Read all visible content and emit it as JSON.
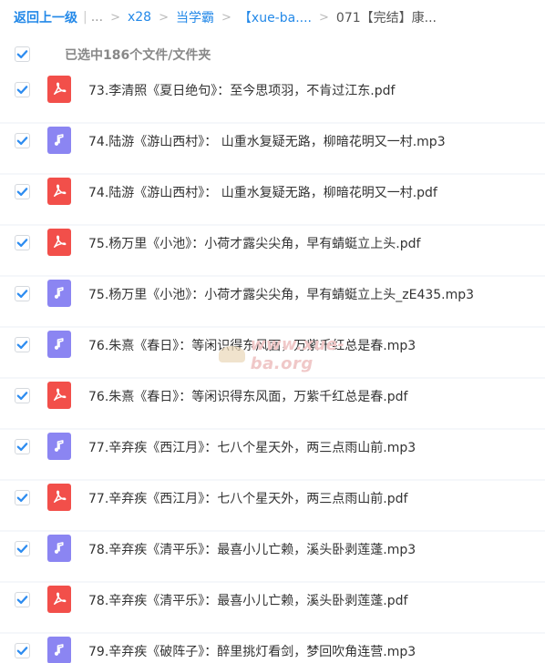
{
  "breadcrumb": {
    "back": "返回上一级",
    "pipe": "|",
    "ellipsis": "...",
    "items": [
      "x28",
      "当学霸",
      "【xue-ba....",
      "071【完结】康..."
    ],
    "separators": [
      ">",
      ">",
      ">",
      ">"
    ]
  },
  "selection": {
    "checked": true,
    "text": "已选中186个文件/文件夹"
  },
  "colors": {
    "link": "#2489e8",
    "checkbox": "#2d8cf0",
    "pdf": "#f24f4a",
    "mp3": "#8b85f2"
  },
  "files": [
    {
      "name": "73.李清照《夏日绝句》：至今思项羽，不肯过江东.pdf",
      "type": "pdf",
      "icon": "pdf-icon",
      "checked": true
    },
    {
      "name": "74.陆游《游山西村》： 山重水复疑无路，柳暗花明又一村.mp3",
      "type": "mp3",
      "icon": "music-note-icon",
      "checked": true
    },
    {
      "name": "74.陆游《游山西村》： 山重水复疑无路，柳暗花明又一村.pdf",
      "type": "pdf",
      "icon": "pdf-icon",
      "checked": true
    },
    {
      "name": "75.杨万里《小池》：小荷才露尖尖角，早有蜻蜓立上头.pdf",
      "type": "pdf",
      "icon": "pdf-icon",
      "checked": true
    },
    {
      "name": "75.杨万里《小池》：小荷才露尖尖角，早有蜻蜓立上头_zE435.mp3",
      "type": "mp3",
      "icon": "music-note-icon",
      "checked": true
    },
    {
      "name": "76.朱熹《春日》：等闲识得东风面，万紫千红总是春.mp3",
      "type": "mp3",
      "icon": "music-note-icon",
      "checked": true
    },
    {
      "name": "76.朱熹《春日》：等闲识得东风面，万紫千红总是春.pdf",
      "type": "pdf",
      "icon": "pdf-icon",
      "checked": true
    },
    {
      "name": "77.辛弃疾《西江月》：七八个星天外，两三点雨山前.mp3",
      "type": "mp3",
      "icon": "music-note-icon",
      "checked": true
    },
    {
      "name": "77.辛弃疾《西江月》：七八个星天外，两三点雨山前.pdf",
      "type": "pdf",
      "icon": "pdf-icon",
      "checked": true
    },
    {
      "name": "78.辛弃疾《清平乐》：最喜小儿亡赖，溪头卧剥莲蓬.mp3",
      "type": "mp3",
      "icon": "music-note-icon",
      "checked": true
    },
    {
      "name": "78.辛弃疾《清平乐》：最喜小儿亡赖，溪头卧剥莲蓬.pdf",
      "type": "pdf",
      "icon": "pdf-icon",
      "checked": true
    },
    {
      "name": "79.辛弃疾《破阵子》：醉里挑灯看剑，梦回吹角连营.mp3",
      "type": "mp3",
      "icon": "music-note-icon",
      "checked": true
    }
  ],
  "watermark": {
    "text": "www.xue-ba.org"
  }
}
